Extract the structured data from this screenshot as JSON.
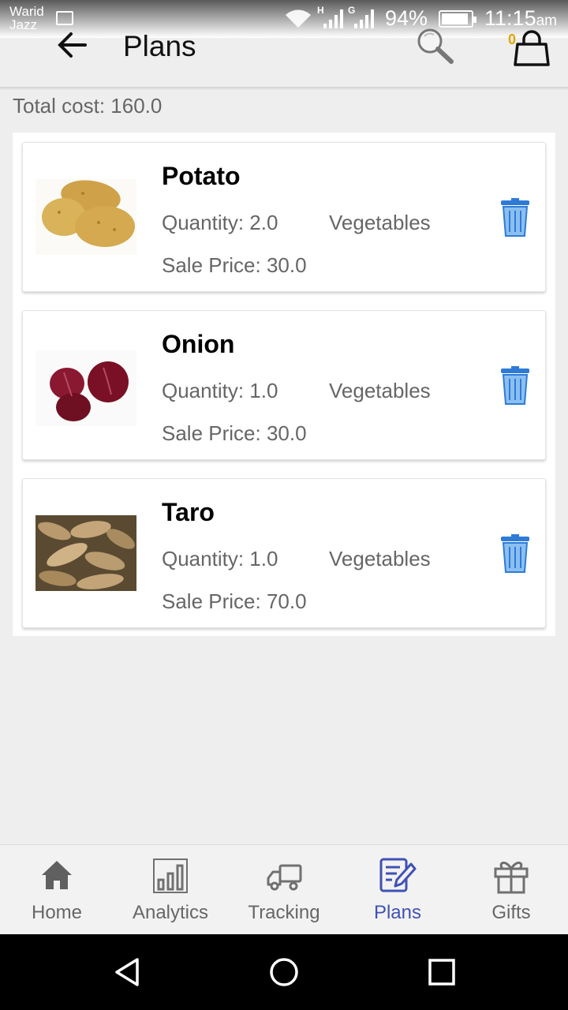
{
  "status_bar": {
    "carrier_line1": "Warid",
    "carrier_line2": "Jazz",
    "net1": "H",
    "net2": "G",
    "battery": "94%",
    "time": "11:15",
    "ampm": "am"
  },
  "app_bar": {
    "title": "Plans",
    "cart_count": "0"
  },
  "total_cost": "Total cost: 160.0",
  "items": [
    {
      "name": "Potato",
      "quantity": "Quantity: 2.0",
      "category": "Vegetables",
      "sale_price": "Sale Price: 30.0"
    },
    {
      "name": "Onion",
      "quantity": "Quantity: 1.0",
      "category": "Vegetables",
      "sale_price": "Sale Price: 30.0"
    },
    {
      "name": "Taro",
      "quantity": "Quantity: 1.0",
      "category": "Vegetables",
      "sale_price": "Sale Price: 70.0"
    }
  ],
  "bottom_nav": [
    {
      "label": "Home",
      "icon": "home-icon",
      "active": false
    },
    {
      "label": "Analytics",
      "icon": "bar-chart-icon",
      "active": false
    },
    {
      "label": "Tracking",
      "icon": "truck-icon",
      "active": false
    },
    {
      "label": "Plans",
      "icon": "edit-note-icon",
      "active": true
    },
    {
      "label": "Gifts",
      "icon": "gift-icon",
      "active": false
    }
  ],
  "colors": {
    "accent": "#3f51b5",
    "trash_blue": "#4a90e2",
    "cart_badge": "#e7a300"
  }
}
